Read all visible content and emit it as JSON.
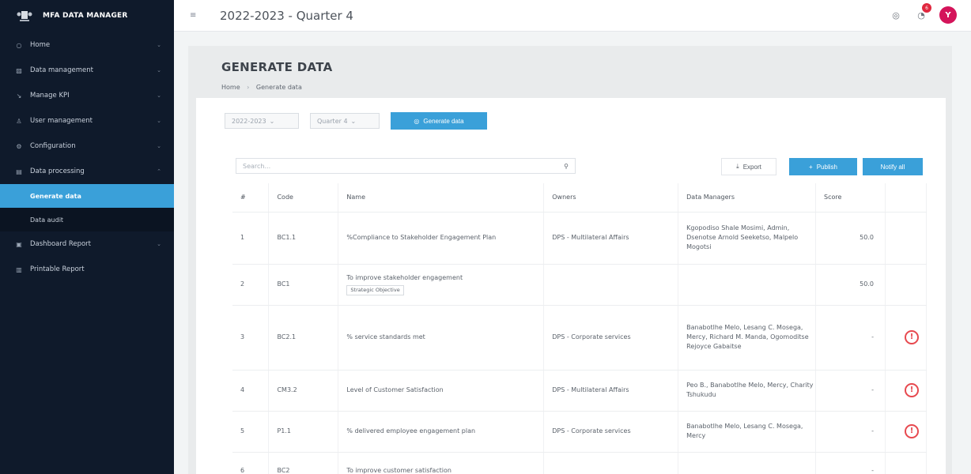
{
  "app": {
    "title": "MFA DATA MANAGER"
  },
  "topbar": {
    "period": "2022-2023 - Quarter 4",
    "notifications": "6",
    "avatar_initial": "Y"
  },
  "sidebar": {
    "items": [
      {
        "label": "Home",
        "icon": "home-icon"
      },
      {
        "label": "Data management",
        "icon": "edit-icon"
      },
      {
        "label": "Manage KPI",
        "icon": "chart-icon"
      },
      {
        "label": "User management",
        "icon": "user-icon"
      },
      {
        "label": "Configuration",
        "icon": "gear-icon"
      },
      {
        "label": "Data processing",
        "icon": "table-icon"
      }
    ],
    "sub_items": [
      {
        "label": "Generate data",
        "active": true
      },
      {
        "label": "Data audit",
        "active": false
      }
    ],
    "items_after": [
      {
        "label": "Dashboard Report",
        "icon": "dashboard-icon"
      },
      {
        "label": "Printable Report",
        "icon": "printer-icon"
      }
    ]
  },
  "page": {
    "title": "GENERATE DATA",
    "breadcrumb": {
      "home": "Home",
      "current": "Generate data"
    }
  },
  "filters": {
    "year": "2022-2023",
    "quarter": "Quarter 4",
    "generate_label": "Generate data"
  },
  "toolbar": {
    "search_placeholder": "Search...",
    "export_label": "Export",
    "publish_label": "Publish",
    "notify_label": "Notify all"
  },
  "table": {
    "headers": [
      "#",
      "Code",
      "Name",
      "Owners",
      "Data Managers",
      "Score"
    ],
    "rows": [
      {
        "num": "1",
        "code": "BC1.1",
        "name": "%Compliance to Stakeholder Engagement Plan",
        "tag": "",
        "owners": "DPS - Multilateral Affairs",
        "managers": "Kgopodiso Shale Mosimi, Admin, Dsenotse Arnold Seeketso, Malpelo Mogotsi",
        "score": "50.0",
        "warn": false
      },
      {
        "num": "2",
        "code": "BC1",
        "name": "To improve stakeholder engagement",
        "tag": "Strategic Objective",
        "owners": "",
        "managers": "",
        "score": "50.0",
        "warn": false
      },
      {
        "num": "3",
        "code": "BC2.1",
        "name": "% service standards met",
        "tag": "",
        "owners": "DPS - Corporate services",
        "managers": "Banabotlhe Melo, Lesang C. Mosega, Mercy, Richard M. Manda, Ogomoditse Rejoyce Gabaitse",
        "score": "-",
        "warn": true
      },
      {
        "num": "4",
        "code": "CM3.2",
        "name": "Level of Customer Satisfaction",
        "tag": "",
        "owners": "DPS - Multilateral Affairs",
        "managers": "Peo B., Banabotlhe Melo, Mercy, Charity Tshukudu",
        "score": "-",
        "warn": true
      },
      {
        "num": "5",
        "code": "P1.1",
        "name": "% delivered employee engagement plan",
        "tag": "",
        "owners": "DPS - Corporate services",
        "managers": "Banabotlhe Melo, Lesang C. Mosega, Mercy",
        "score": "-",
        "warn": true
      },
      {
        "num": "6",
        "code": "BC2",
        "name": "To improve customer satisfaction",
        "tag": "",
        "owners": "",
        "managers": "",
        "score": "-",
        "warn": false
      }
    ]
  },
  "colors": {
    "sidebar_bg": "#0f1a2b",
    "accent": "#3aa0d9",
    "warning": "#e7494f",
    "avatar": "#d4145a"
  }
}
